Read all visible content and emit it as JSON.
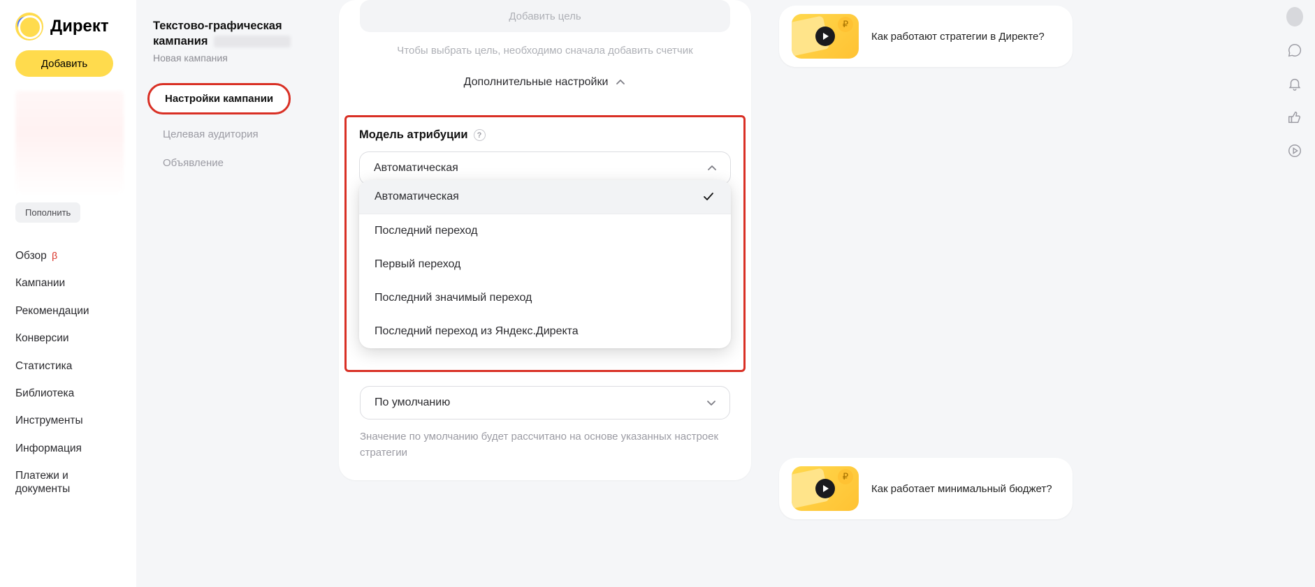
{
  "brand": {
    "name": "Директ"
  },
  "sidebar": {
    "add_label": "Добавить",
    "top_up_label": "Пополнить",
    "nav": [
      {
        "label": "Обзор",
        "beta": "β"
      },
      {
        "label": "Кампании"
      },
      {
        "label": "Рекомендации"
      },
      {
        "label": "Конверсии"
      },
      {
        "label": "Статистика"
      },
      {
        "label": "Библиотека"
      },
      {
        "label": "Инструменты"
      },
      {
        "label": "Информация"
      },
      {
        "label": "Платежи и документы"
      }
    ]
  },
  "steps_panel": {
    "title_line1": "Текстово-графическая",
    "title_line2_prefix": "кампания",
    "subtitle": "Новая кампания",
    "steps": [
      {
        "label": "Настройки кампании",
        "active": true
      },
      {
        "label": "Целевая аудитория",
        "active": false
      },
      {
        "label": "Объявление",
        "active": false
      }
    ]
  },
  "main": {
    "add_goal_label": "Добавить цель",
    "goal_hint": "Чтобы выбрать цель, необходимо сначала добавить счетчик",
    "extra_settings_label": "Дополнительные настройки",
    "attribution": {
      "label": "Модель атрибуции",
      "selected": "Автоматическая",
      "options": [
        "Автоматическая",
        "Последний переход",
        "Первый переход",
        "Последний значимый переход",
        "Последний переход из Яндекс.Директа"
      ]
    },
    "default_select": {
      "value": "По умолчанию"
    },
    "default_hint": "Значение по умолчанию будет рассчитано на основе указанных настроек стратегии"
  },
  "help": {
    "card1": "Как работают стратегии в Директе?",
    "card2": "Как работает минимальный бюджет?"
  },
  "icons": {
    "avatar": "avatar-icon",
    "chat": "chat-icon",
    "bell": "bell-icon",
    "like": "like-icon",
    "play": "play-circle-icon"
  }
}
